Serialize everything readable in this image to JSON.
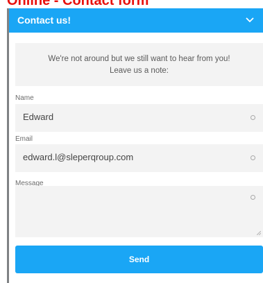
{
  "page_caption": "Online - Contact form",
  "header": {
    "title": "Contact us!",
    "icon": "chevron-down-icon"
  },
  "notice": {
    "line1": "We're not around but we still want to hear from you!",
    "line2": "Leave us a note:"
  },
  "form": {
    "name": {
      "label": "Name",
      "value": "Edward"
    },
    "email": {
      "label": "Email",
      "value": "edward.l@sleperqroup.com"
    },
    "message": {
      "label": "Message",
      "value": ""
    }
  },
  "send_label": "Send",
  "colors": {
    "accent": "#1aa6f5",
    "caption": "#e8100c",
    "field_bg": "#f3f3f3"
  }
}
